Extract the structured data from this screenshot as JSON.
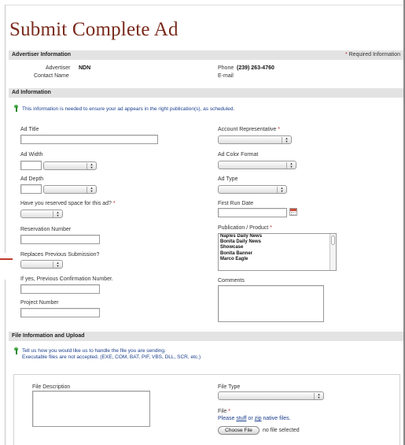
{
  "page": {
    "title": "Submit Complete Ad"
  },
  "advertiser_section": {
    "heading": "Advertiser Information",
    "required_star": "*",
    "required_note": "Required Information",
    "advertiser_label": "Advertiser",
    "advertiser_value": "NDN",
    "contact_label": "Contact Name",
    "phone_label": "Phone",
    "phone_value": "(239) 263-4760",
    "email_label": "E-mail"
  },
  "ad_section": {
    "heading": "Ad Information",
    "info_text": "This information is needed to ensure your ad appears in the right publication(s), as scheduled.",
    "fields": {
      "ad_title": "Ad Title",
      "ad_width": "Ad Width",
      "ad_depth": "Ad Depth",
      "reserved_space": "Have you reserved space for this ad?",
      "reservation_number": "Reservation Number",
      "replaces_previous": "Replaces Previous Submission?",
      "previous_confirmation": "If yes, Previous Confirmation Number.",
      "project_number": "Project Number",
      "account_rep": "Account Representative",
      "ad_color_format": "Ad Color Format",
      "ad_type": "Ad Type",
      "first_run_date": "First Run Date",
      "publication_product": "Publication / Product",
      "comments": "Comments"
    },
    "required_star": "*",
    "publications": [
      "Naples Daily News",
      "Bonita Daily News",
      "Showcase",
      "Bonita Banner",
      "Marco Eagle"
    ]
  },
  "file_section": {
    "heading": "File Information and Upload",
    "info_line1": "Tell us how you would like us to handle the file you are sending.",
    "info_line2": "Executable files are not accepted. (EXE, COM, BAT, PIF, VBS, DLL, SCR, etc.)",
    "file_description": "File Description",
    "file_type": "File Type",
    "file_label": "File",
    "required_star": "*",
    "please_text": "Please",
    "stuff_link": "stuff",
    "or_text": "or",
    "zip_link": "zip",
    "native_text": "native files.",
    "choose_button": "Choose File",
    "no_file": "no file selected"
  }
}
